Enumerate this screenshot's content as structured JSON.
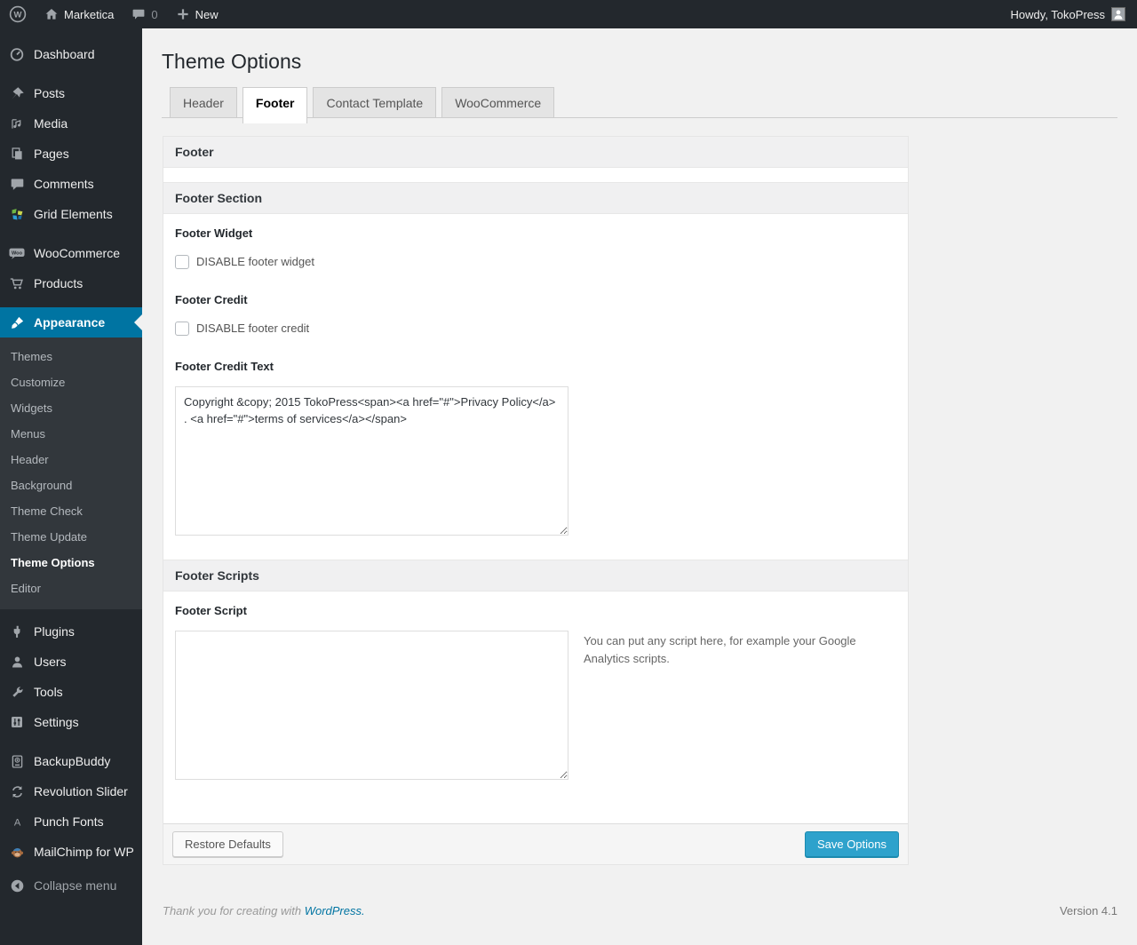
{
  "admin_bar": {
    "site_name": "Marketica",
    "comment_count": "0",
    "new_label": "New",
    "howdy": "Howdy, TokoPress"
  },
  "sidebar": {
    "items": [
      "Dashboard",
      "Posts",
      "Media",
      "Pages",
      "Comments",
      "Grid Elements",
      "WooCommerce",
      "Products",
      "Appearance",
      "Plugins",
      "Users",
      "Tools",
      "Settings",
      "BackupBuddy",
      "Revolution Slider",
      "Punch Fonts",
      "MailChimp for WP"
    ],
    "submenu": [
      "Themes",
      "Customize",
      "Widgets",
      "Menus",
      "Header",
      "Background",
      "Theme Check",
      "Theme Update",
      "Theme Options",
      "Editor"
    ],
    "collapse_label": "Collapse menu"
  },
  "page": {
    "title": "Theme Options",
    "tabs": [
      {
        "label": "Header"
      },
      {
        "label": "Footer"
      },
      {
        "label": "Contact Template"
      },
      {
        "label": "WooCommerce"
      }
    ]
  },
  "panel": {
    "header": "Footer",
    "section_title": "Footer Section",
    "footer_widget_label": "Footer Widget",
    "footer_widget_checkbox": "DISABLE footer widget",
    "footer_credit_label": "Footer Credit",
    "footer_credit_checkbox": "DISABLE footer credit",
    "footer_credit_text_label": "Footer Credit Text",
    "footer_credit_text_value": "Copyright &copy; 2015 TokoPress<span><a href=\"#\">Privacy Policy</a> . <a href=\"#\">terms of services</a></span>",
    "scripts_section_title": "Footer Scripts",
    "footer_script_label": "Footer Script",
    "footer_script_value": "",
    "footer_script_help": "You can put any script here, for example your Google Analytics scripts.",
    "restore_button": "Restore Defaults",
    "save_button": "Save Options"
  },
  "footer": {
    "thanks_prefix": "Thank you for creating with ",
    "wordpress_link": "WordPress.",
    "version": "Version 4.1"
  },
  "colors": {
    "admin_bg": "#23282d",
    "submenu_bg": "#32373c",
    "menu_highlight": "#0074a2",
    "primary_button": "#2ea2cc",
    "page_bg": "#f1f1f1",
    "link": "#0074a2"
  }
}
